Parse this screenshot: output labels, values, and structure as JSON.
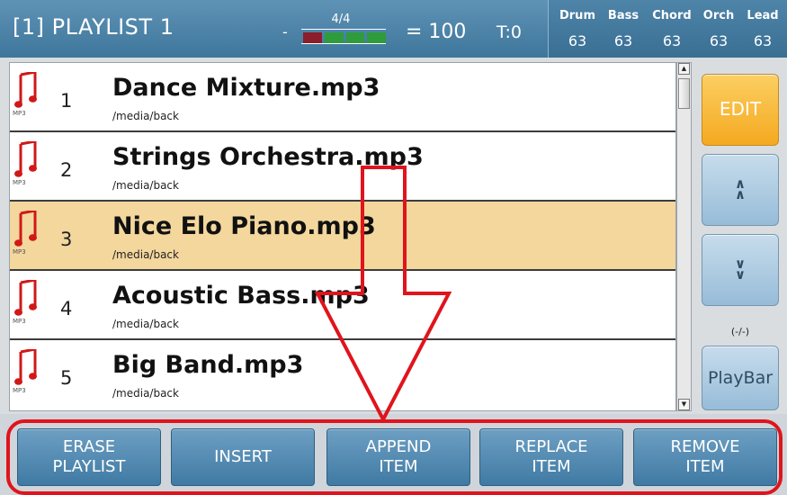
{
  "header": {
    "title": "[1] PLAYLIST 1",
    "meter_dash": "-",
    "time_signature": "4/4",
    "meter_blocks": [
      "#8b1e2a",
      "#2f9c3c",
      "#2f9c3c",
      "#2f9c3c"
    ],
    "tempo": "= 100",
    "transpose": "T:0",
    "volumes": [
      {
        "name": "Drum",
        "value": "63"
      },
      {
        "name": "Bass",
        "value": "63"
      },
      {
        "name": "Chord",
        "value": "63"
      },
      {
        "name": "Orch",
        "value": "63"
      },
      {
        "name": "Lead",
        "value": "63"
      }
    ]
  },
  "playlist": {
    "items": [
      {
        "number": "1",
        "name": "Dance Mixture.mp3",
        "path": "/media/back",
        "format": "MP3",
        "selected": false
      },
      {
        "number": "2",
        "name": "Strings Orchestra.mp3",
        "path": "/media/back",
        "format": "MP3",
        "selected": false
      },
      {
        "number": "3",
        "name": "Nice Elo Piano.mp3",
        "path": "/media/back",
        "format": "MP3",
        "selected": true
      },
      {
        "number": "4",
        "name": "Acoustic Bass.mp3",
        "path": "/media/back",
        "format": "MP3",
        "selected": false
      },
      {
        "number": "5",
        "name": "Big Band.mp3",
        "path": "/media/back",
        "format": "MP3",
        "selected": false
      }
    ]
  },
  "side": {
    "edit_label": "EDIT",
    "up_glyph": "∧",
    "down_glyph": "∨",
    "position_indicator": "(-/-)",
    "playbar_label": "PlayBar"
  },
  "bottom": {
    "buttons": [
      {
        "line1": "ERASE",
        "line2": "PLAYLIST"
      },
      {
        "line1": "INSERT",
        "line2": ""
      },
      {
        "line1": "APPEND",
        "line2": "ITEM"
      },
      {
        "line1": "REPLACE",
        "line2": "ITEM"
      },
      {
        "line1": "REMOVE",
        "line2": "ITEM"
      }
    ]
  },
  "colors": {
    "header_blue": "#4a82a8",
    "selected_row": "#f3d79d",
    "edit_orange": "#f8b93c",
    "annotation_red": "#e0141c",
    "note_red": "#d01818"
  },
  "icons": {
    "file_icon": "music-note-icon",
    "scroll_up": "scroll-up-arrow-icon",
    "scroll_down": "scroll-down-arrow-icon"
  }
}
